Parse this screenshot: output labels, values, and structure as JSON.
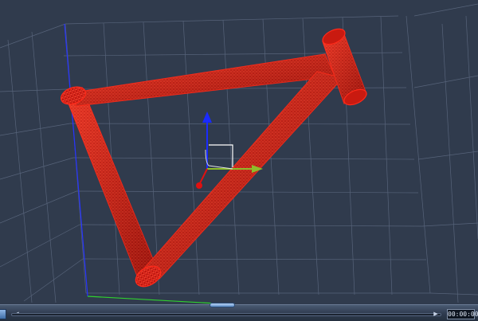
{
  "viewport": {
    "background": "#303b4d",
    "grid_color": "#5e6b82",
    "axis_colors": {
      "x": "#2fd12f",
      "y": "#2633ff",
      "z": "#2f6bff"
    },
    "mesh_color": "#ff2a1a",
    "object": "bicycle-frame-wireframe"
  },
  "gizmo": {
    "up_color": "#1a2bff",
    "left_color": "#e01010",
    "right_color": "#8dbd2a",
    "icon": "transform-gizmo-icon"
  },
  "timeline": {
    "time": "00:00:00",
    "play_icon": "play-icon",
    "prev_icon": "step-back-icon",
    "next_icon": "step-forward-icon"
  }
}
